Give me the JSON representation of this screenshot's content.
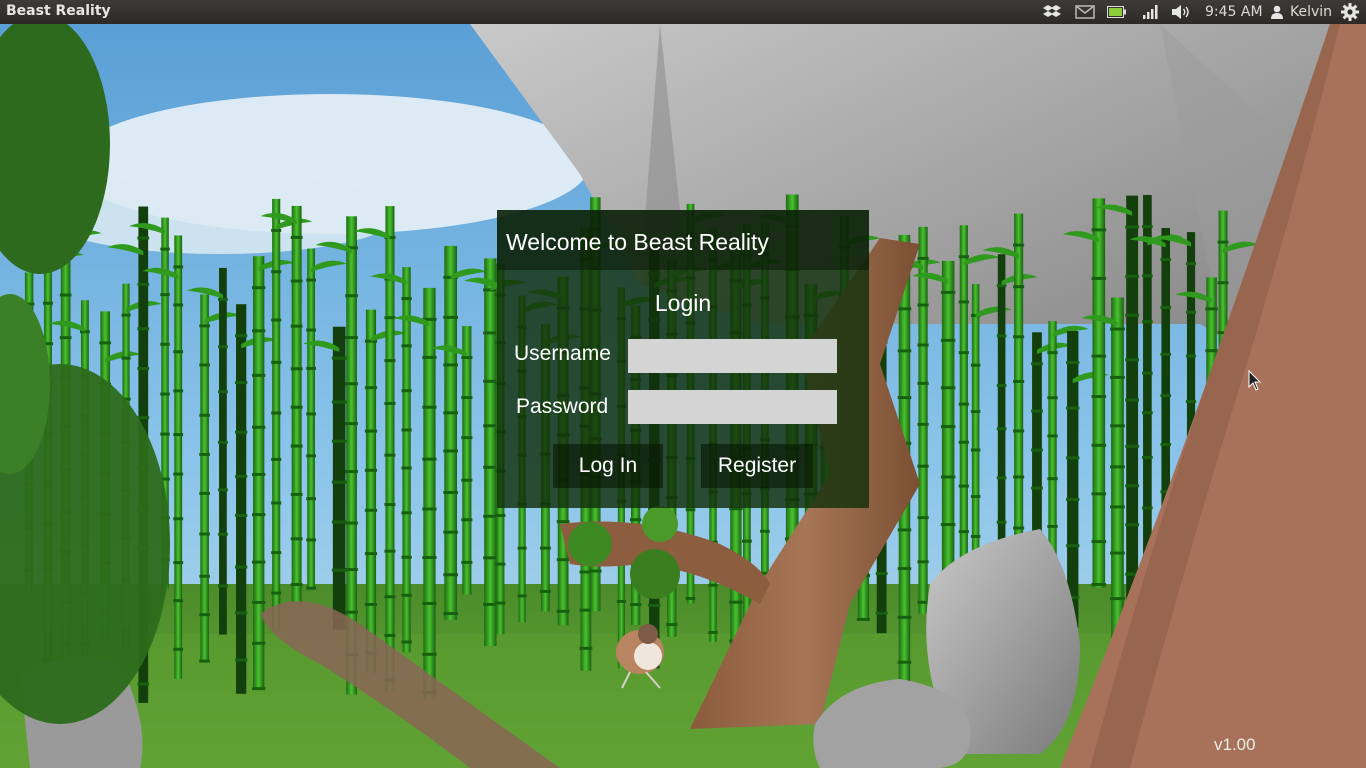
{
  "topbar": {
    "app_title": "Beast Reality",
    "clock": "9:45 AM",
    "user": "Kelvin",
    "icons": [
      "dropbox-icon",
      "mail-icon",
      "battery-icon",
      "network-signal-icon",
      "volume-icon",
      "user-icon",
      "gear-icon"
    ]
  },
  "dialog": {
    "title": "Welcome to Beast Reality",
    "heading": "Login",
    "username_label": "Username",
    "username_value": "",
    "password_label": "Password",
    "password_value": "",
    "login_button": "Log In",
    "register_button": "Register"
  },
  "version": "v1.00",
  "colors": {
    "panel": "#2b2a27",
    "dialog_bg": "#12300c",
    "input_bg": "#d4d4d4",
    "battery": "#8ccb3c"
  }
}
